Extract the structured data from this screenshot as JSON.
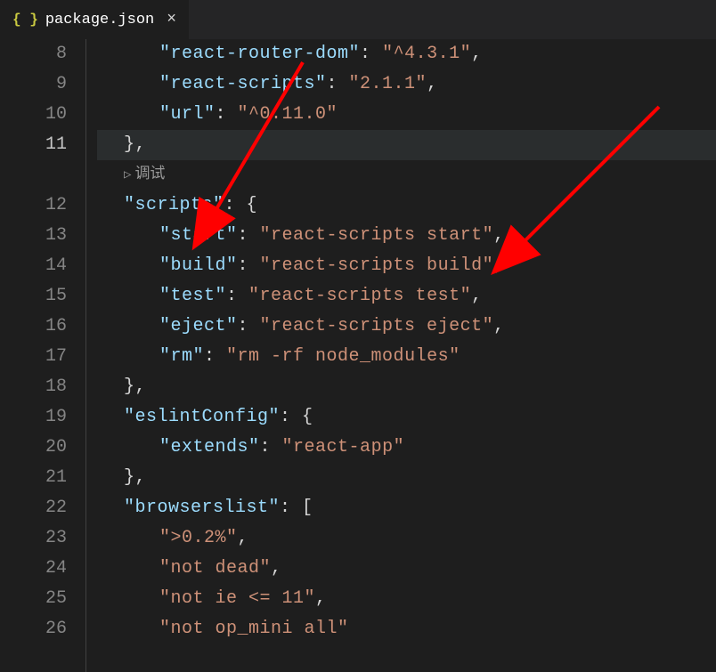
{
  "tab": {
    "icon": "{ }",
    "name": "package.json",
    "close": "×"
  },
  "gutter": {
    "numbers": [
      "8",
      "9",
      "10",
      "11",
      "12",
      "13",
      "14",
      "15",
      "16",
      "17",
      "18",
      "19",
      "20",
      "21",
      "22",
      "23",
      "24",
      "25",
      "26"
    ],
    "active": "11"
  },
  "codelens": {
    "icon": "▷",
    "label": "调试"
  },
  "code": {
    "l8": {
      "key": "\"react-router-dom\"",
      "val": "\"^4.3.1\"",
      "end": ","
    },
    "l9": {
      "key": "\"react-scripts\"",
      "val": "\"2.1.1\"",
      "end": ","
    },
    "l10": {
      "key": "\"url\"",
      "val": "\"^0.11.0\""
    },
    "l11": {
      "text": "},"
    },
    "l12": {
      "key": "\"scripts\"",
      "brace": "{"
    },
    "l13": {
      "key": "\"start\"",
      "val": "\"react-scripts start\"",
      "end": ","
    },
    "l14": {
      "key": "\"build\"",
      "val": "\"react-scripts build\"",
      "end": ","
    },
    "l15": {
      "key": "\"test\"",
      "val": "\"react-scripts test\"",
      "end": ","
    },
    "l16": {
      "key": "\"eject\"",
      "val": "\"react-scripts eject\"",
      "end": ","
    },
    "l17": {
      "key": "\"rm\"",
      "val": "\"rm -rf node_modules\""
    },
    "l18": {
      "text": "},"
    },
    "l19": {
      "key": "\"eslintConfig\"",
      "brace": "{"
    },
    "l20": {
      "key": "\"extends\"",
      "val": "\"react-app\""
    },
    "l21": {
      "text": "},"
    },
    "l22": {
      "key": "\"browserslist\"",
      "brace": "["
    },
    "l23": {
      "val": "\">0.2%\"",
      "end": ","
    },
    "l24": {
      "val": "\"not dead\"",
      "end": ","
    },
    "l25": {
      "val": "\"not ie <= 11\"",
      "end": ","
    },
    "l26": {
      "val": "\"not op_mini all\""
    }
  },
  "colon": ": "
}
